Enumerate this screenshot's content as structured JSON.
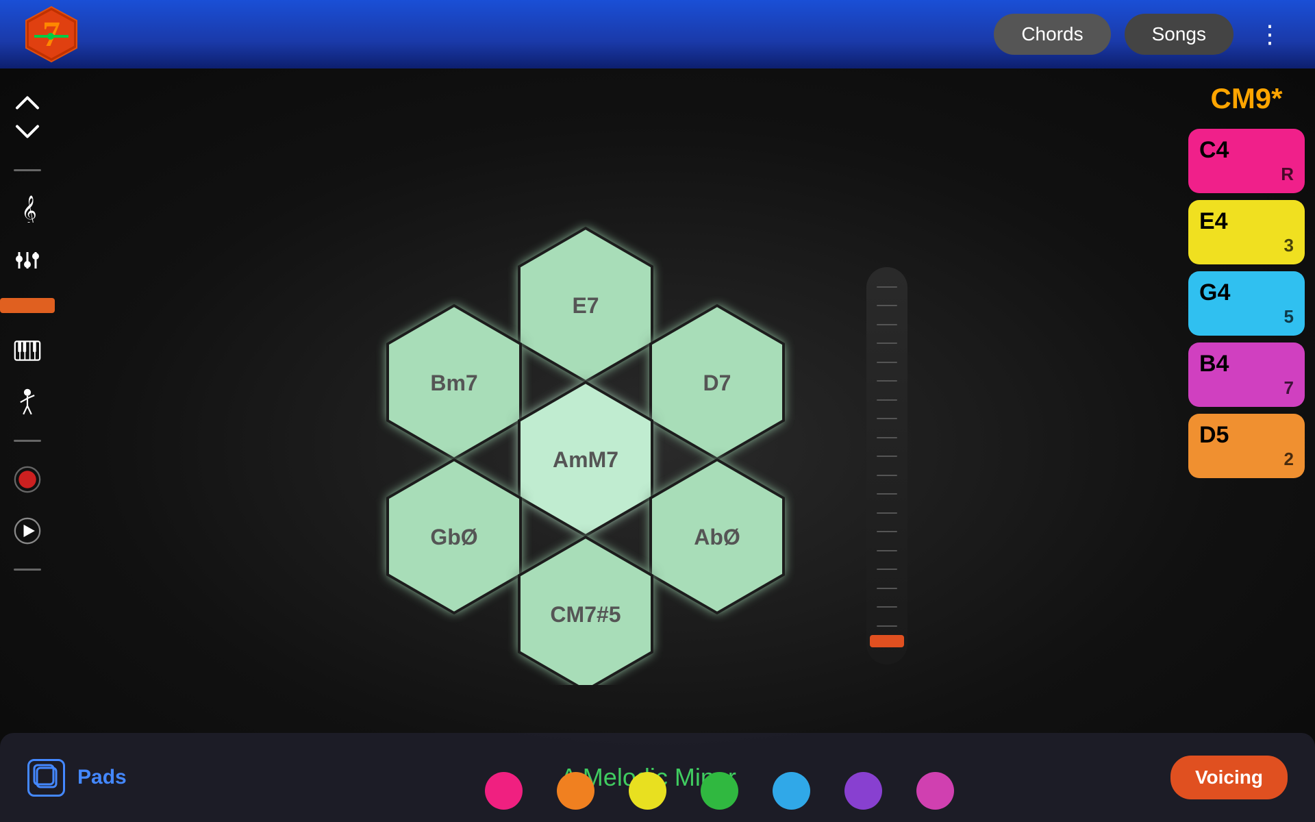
{
  "header": {
    "nav": {
      "chords_label": "Chords",
      "songs_label": "Songs",
      "dots": "⋮"
    }
  },
  "sidebar": {
    "icons": [
      "chevron-up",
      "chevron-down",
      "music-note",
      "mixer",
      "piano",
      "conductor",
      "record",
      "play"
    ]
  },
  "chord_display": {
    "title": "CM9*",
    "notes": [
      {
        "name": "C4",
        "role": "R",
        "color": "card-pink"
      },
      {
        "name": "E4",
        "role": "3",
        "color": "card-yellow"
      },
      {
        "name": "G4",
        "role": "5",
        "color": "card-cyan"
      },
      {
        "name": "B4",
        "role": "7",
        "color": "card-magenta"
      },
      {
        "name": "D5",
        "role": "2",
        "color": "card-orange"
      }
    ]
  },
  "hex_pads": [
    {
      "id": "top",
      "label": "E7"
    },
    {
      "id": "top-right",
      "label": "D7"
    },
    {
      "id": "top-left",
      "label": "Bm7"
    },
    {
      "id": "center",
      "label": "AmM7"
    },
    {
      "id": "bottom-left",
      "label": "GbØ"
    },
    {
      "id": "bottom-right",
      "label": "AbØ"
    },
    {
      "id": "bottom",
      "label": "CM7#5"
    }
  ],
  "bottom_bar": {
    "pads_label": "Pads",
    "scale_name": "A Melodic Minor",
    "voicing_label": "Voicing"
  },
  "color_dots": [
    "#f02080",
    "#f08020",
    "#e8e020",
    "#30b840",
    "#30a8e8",
    "#8840d0",
    "#d040b0"
  ]
}
